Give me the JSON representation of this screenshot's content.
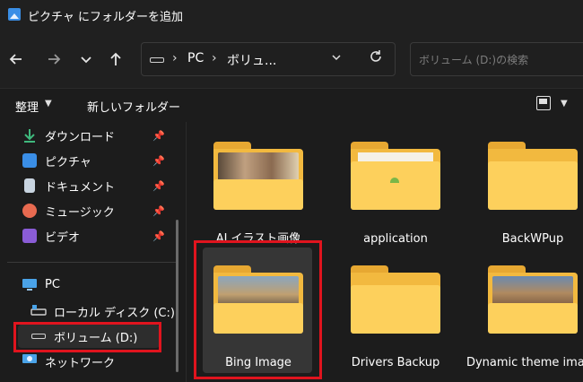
{
  "window": {
    "title": "ピクチャ にフォルダーを追加"
  },
  "nav": {
    "back_icon": "arrow-left-icon",
    "forward_icon": "arrow-right-icon",
    "recent_icon": "chevron-down-icon",
    "up_icon": "arrow-up-icon",
    "breadcrumb": [
      "PC",
      "ボリュ..."
    ],
    "refresh_icon": "refresh-icon",
    "search_placeholder": "ボリューム (D:)の検索"
  },
  "toolbar": {
    "organize_label": "整理",
    "new_folder_label": "新しいフォルダー"
  },
  "sidebar": {
    "quick_access": [
      {
        "label": "ダウンロード",
        "icon": "download-icon",
        "color": "#3fb97d",
        "pinned": true
      },
      {
        "label": "ピクチャ",
        "icon": "pictures-icon",
        "color": "#3a8ee6",
        "pinned": true
      },
      {
        "label": "ドキュメント",
        "icon": "documents-icon",
        "color": "#c8d4e0",
        "pinned": true
      },
      {
        "label": "ミュージック",
        "icon": "music-icon",
        "color": "#e86a50",
        "pinned": true
      },
      {
        "label": "ビデオ",
        "icon": "video-icon",
        "color": "#8a5cd6",
        "pinned": true
      }
    ],
    "pc_label": "PC",
    "drives": [
      {
        "label": "ローカル ディスク (C:)",
        "icon": "local-disk-icon"
      },
      {
        "label": "ボリューム (D:)",
        "icon": "drive-icon",
        "selected": true
      }
    ],
    "network_label": "ネットワーク"
  },
  "folders": [
    {
      "name": "AI イラスト画像",
      "thumb": "#8a7a6a"
    },
    {
      "name": "application",
      "thumb": "#f5f1e6"
    },
    {
      "name": "BackWPup",
      "thumb": ""
    },
    {
      "name": "Bing Image",
      "thumb": "#6e8aa8",
      "selected": true
    },
    {
      "name": "Drivers Backup",
      "thumb": ""
    },
    {
      "name": "Dynamic theme image",
      "thumb": "#a08468"
    }
  ],
  "colors": {
    "highlight": "#e0141e",
    "accent": "#3a8ee6",
    "folder": "#fdd05c"
  }
}
